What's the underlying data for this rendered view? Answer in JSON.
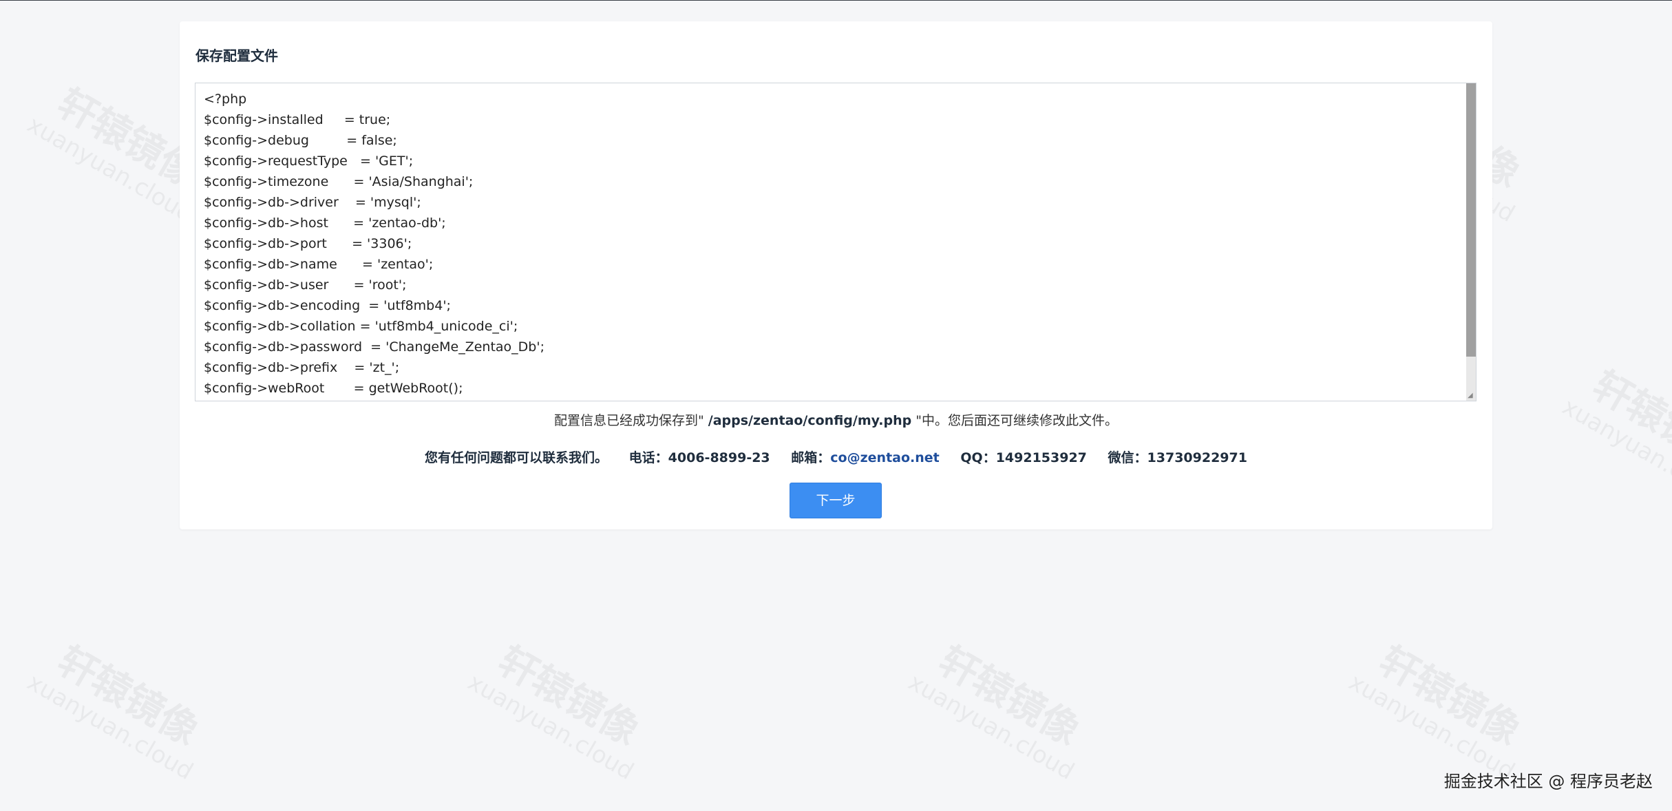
{
  "watermark": {
    "cn": "轩辕镜像",
    "en": "xuanyuan.cloud"
  },
  "panel": {
    "title": "保存配置文件",
    "code_lines": [
      "<?php",
      "$config->installed     = true;",
      "$config->debug         = false;",
      "$config->requestType   = 'GET';",
      "$config->timezone      = 'Asia/Shanghai';",
      "$config->db->driver    = 'mysql';",
      "$config->db->host      = 'zentao-db';",
      "$config->db->port      = '3306';",
      "$config->db->name      = 'zentao';",
      "$config->db->user      = 'root';",
      "$config->db->encoding  = 'utf8mb4';",
      "$config->db->collation = 'utf8mb4_unicode_ci';",
      "$config->db->password  = 'ChangeMe_Zentao_Db';",
      "$config->db->prefix    = 'zt_';",
      "$config->webRoot       = getWebRoot();"
    ],
    "saved_msg_prefix": "配置信息已经成功保存到\" ",
    "saved_path": "/apps/zentao/config/my.php",
    "saved_msg_suffix": " \"中。您后面还可继续修改此文件。",
    "contact": {
      "intro": "您有任何问题都可以联系我们。",
      "phone": "电话：4006-8899-23",
      "email_label": "邮箱：",
      "email": "co@zentao.net",
      "qq": "QQ：1492153927",
      "wechat": "微信：13730922971"
    },
    "next_button": "下一步"
  },
  "credit": "掘金技术社区 @ 程序员老赵"
}
